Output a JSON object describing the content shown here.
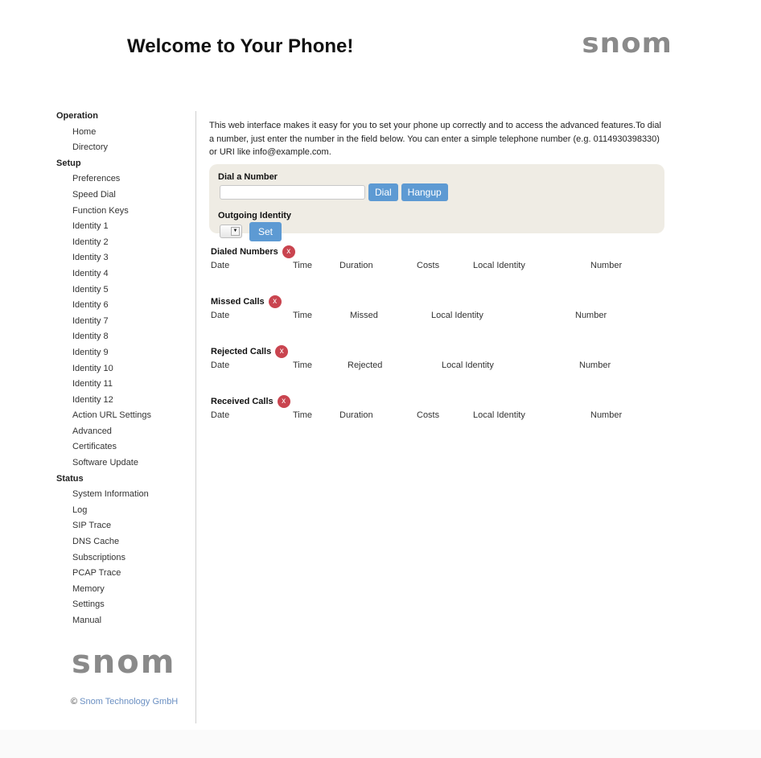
{
  "header": {
    "title": "Welcome to Your Phone!",
    "logo_text": "snom"
  },
  "sidebar": {
    "groups": [
      {
        "label": "Operation",
        "items": [
          "Home",
          "Directory"
        ]
      },
      {
        "label": "Setup",
        "items": [
          "Preferences",
          "Speed Dial",
          "Function Keys",
          "Identity 1",
          "Identity 2",
          "Identity 3",
          "Identity 4",
          "Identity 5",
          "Identity 6",
          "Identity 7",
          "Identity 8",
          "Identity 9",
          "Identity 10",
          "Identity 11",
          "Identity 12",
          "Action URL Settings",
          "Advanced",
          "Certificates",
          "Software Update"
        ]
      },
      {
        "label": "Status",
        "items": [
          "System Information",
          "Log",
          "SIP Trace",
          "DNS Cache",
          "Subscriptions",
          "PCAP Trace",
          "Memory",
          "Settings",
          "Manual"
        ]
      }
    ],
    "logo_text": "snom",
    "copyright_symbol": "©",
    "copyright_link": "Snom Technology GmbH"
  },
  "main": {
    "intro": "This web interface makes it easy for you to set your phone up correctly and to access the advanced features.To dial a number, just enter the number in the field below. You can enter a simple telephone number (e.g. 0114930398330) or URI like info@example.com.",
    "dial": {
      "label": "Dial a Number",
      "input_value": "",
      "dial_button": "Dial",
      "hangup_button": "Hangup"
    },
    "identity": {
      "label": "Outgoing Identity",
      "selected": "",
      "set_button": "Set"
    },
    "clear_icon_glyph": "x",
    "lists": [
      {
        "title": "Dialed Numbers",
        "columns": [
          "Date",
          "Time",
          "Duration",
          "Costs",
          "Local Identity",
          "Number"
        ]
      },
      {
        "title": "Missed Calls",
        "columns": [
          "Date",
          "Time",
          "Missed",
          "Local Identity",
          "Number"
        ]
      },
      {
        "title": "Rejected Calls",
        "columns": [
          "Date",
          "Time",
          "Rejected",
          "Local Identity",
          "Number"
        ]
      },
      {
        "title": "Received Calls",
        "columns": [
          "Date",
          "Time",
          "Duration",
          "Costs",
          "Local Identity",
          "Number"
        ]
      }
    ]
  },
  "colors": {
    "button": "#5d9ad3",
    "panel_bg": "#efece4",
    "clear_icon": "#c9444f",
    "link": "#6a8fc2",
    "logo": "#8a8a8a"
  }
}
